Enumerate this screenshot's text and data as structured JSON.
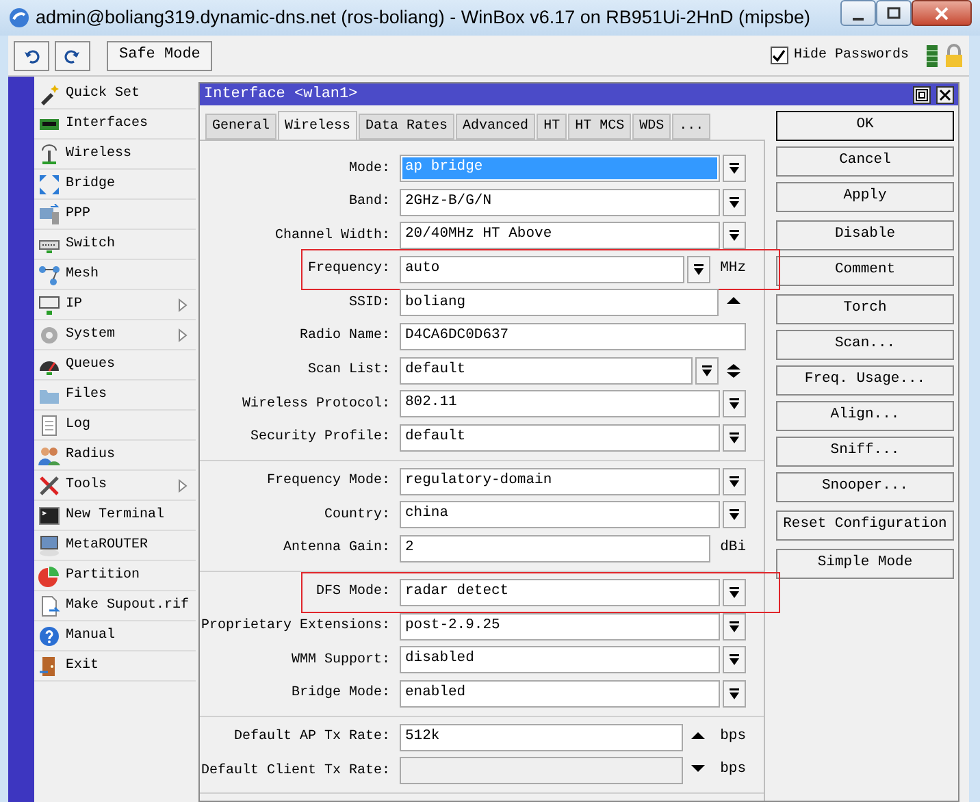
{
  "window": {
    "title": "admin@boliang319.dynamic-dns.net (ros-boliang) - WinBox v6.17 on RB951Ui-2HnD (mipsbe)"
  },
  "toolbar": {
    "safe_mode": "Safe Mode",
    "hide_passwords": {
      "label": "Hide Passwords",
      "checked": true
    }
  },
  "menu": [
    {
      "label": "Quick Set",
      "submenu": false
    },
    {
      "label": "Interfaces",
      "submenu": false
    },
    {
      "label": "Wireless",
      "submenu": false
    },
    {
      "label": "Bridge",
      "submenu": false
    },
    {
      "label": "PPP",
      "submenu": false
    },
    {
      "label": "Switch",
      "submenu": false
    },
    {
      "label": "Mesh",
      "submenu": false
    },
    {
      "label": "IP",
      "submenu": true
    },
    {
      "label": "System",
      "submenu": true
    },
    {
      "label": "Queues",
      "submenu": false
    },
    {
      "label": "Files",
      "submenu": false
    },
    {
      "label": "Log",
      "submenu": false
    },
    {
      "label": "Radius",
      "submenu": false
    },
    {
      "label": "Tools",
      "submenu": true
    },
    {
      "label": "New Terminal",
      "submenu": false
    },
    {
      "label": "MetaROUTER",
      "submenu": false
    },
    {
      "label": "Partition",
      "submenu": false
    },
    {
      "label": "Make Supout.rif",
      "submenu": false
    },
    {
      "label": "Manual",
      "submenu": false
    },
    {
      "label": "Exit",
      "submenu": false
    }
  ],
  "dialog": {
    "title": "Interface <wlan1>",
    "tabs": [
      {
        "label": "General",
        "selected": false
      },
      {
        "label": "Wireless",
        "selected": true
      },
      {
        "label": "Data Rates",
        "selected": false
      },
      {
        "label": "Advanced",
        "selected": false
      },
      {
        "label": "HT",
        "selected": false
      },
      {
        "label": "HT MCS",
        "selected": false
      },
      {
        "label": "WDS",
        "selected": false
      },
      {
        "label": "...",
        "selected": false
      }
    ],
    "sections": [
      [
        {
          "label": "Mode:",
          "value": "ap bridge",
          "kind": "select",
          "value_selected": true,
          "highlighted": false,
          "disabled": false
        },
        {
          "label": "Band:",
          "value": "2GHz-B/G/N",
          "kind": "select",
          "value_selected": false,
          "highlighted": false,
          "disabled": false
        },
        {
          "label": "Channel Width:",
          "value": "20/40MHz HT Above",
          "kind": "select",
          "value_selected": false,
          "highlighted": false,
          "disabled": false
        },
        {
          "label": "Frequency:",
          "value": "auto",
          "kind": "select",
          "unit": "MHz",
          "value_selected": false,
          "highlighted": true,
          "disabled": false
        },
        {
          "label": "SSID:",
          "value": "boliang",
          "kind": "textup",
          "value_selected": false,
          "highlighted": false,
          "disabled": false
        },
        {
          "label": "Radio Name:",
          "value": "D4CA6DC0D637",
          "kind": "text",
          "value_selected": false,
          "highlighted": false,
          "disabled": false
        },
        {
          "label": "Scan List:",
          "value": "default",
          "kind": "selectupdown",
          "value_selected": false,
          "highlighted": false,
          "disabled": false
        },
        {
          "label": "Wireless Protocol:",
          "value": "802.11",
          "kind": "select",
          "value_selected": false,
          "highlighted": false,
          "disabled": false
        },
        {
          "label": "Security Profile:",
          "value": "default",
          "kind": "select",
          "value_selected": false,
          "highlighted": false,
          "disabled": false
        }
      ],
      [
        {
          "label": "Frequency Mode:",
          "value": "regulatory-domain",
          "kind": "select",
          "value_selected": false,
          "highlighted": false,
          "disabled": false
        },
        {
          "label": "Country:",
          "value": "china",
          "kind": "select",
          "value_selected": false,
          "highlighted": false,
          "disabled": false
        },
        {
          "label": "Antenna Gain:",
          "value": "2",
          "kind": "text",
          "unit": "dBi",
          "value_selected": false,
          "highlighted": false,
          "disabled": false
        }
      ],
      [
        {
          "label": "DFS Mode:",
          "value": "radar detect",
          "kind": "select",
          "value_selected": false,
          "highlighted": true,
          "disabled": false
        },
        {
          "label": "Proprietary Extensions:",
          "value": "post-2.9.25",
          "kind": "select",
          "value_selected": false,
          "highlighted": false,
          "disabled": false
        },
        {
          "label": "WMM Support:",
          "value": "disabled",
          "kind": "select",
          "value_selected": false,
          "highlighted": false,
          "disabled": false
        },
        {
          "label": "Bridge Mode:",
          "value": "enabled",
          "kind": "select",
          "value_selected": false,
          "highlighted": false,
          "disabled": false
        }
      ],
      [
        {
          "label": "Default AP Tx Rate:",
          "value": "512k",
          "kind": "textup",
          "unit": "bps",
          "value_selected": false,
          "highlighted": false,
          "disabled": false
        },
        {
          "label": "Default Client Tx Rate:",
          "kind": "textdown",
          "unit": "bps",
          "value_selected": false,
          "highlighted": false,
          "disabled": true
        }
      ]
    ],
    "buttons": [
      [
        {
          "label": "OK",
          "default": true
        },
        {
          "label": "Cancel",
          "default": false
        },
        {
          "label": "Apply",
          "default": false
        }
      ],
      [
        {
          "label": "Disable",
          "default": false
        },
        {
          "label": "Comment",
          "default": false
        }
      ],
      [
        {
          "label": "Torch",
          "default": false
        },
        {
          "label": "Scan...",
          "default": false
        },
        {
          "label": "Freq. Usage...",
          "default": false
        },
        {
          "label": "Align...",
          "default": false
        },
        {
          "label": "Sniff...",
          "default": false
        },
        {
          "label": "Snooper...",
          "default": false
        }
      ],
      [
        {
          "label": "Reset Configuration",
          "default": false
        }
      ],
      [
        {
          "label": "Simple Mode",
          "default": false
        }
      ]
    ]
  }
}
